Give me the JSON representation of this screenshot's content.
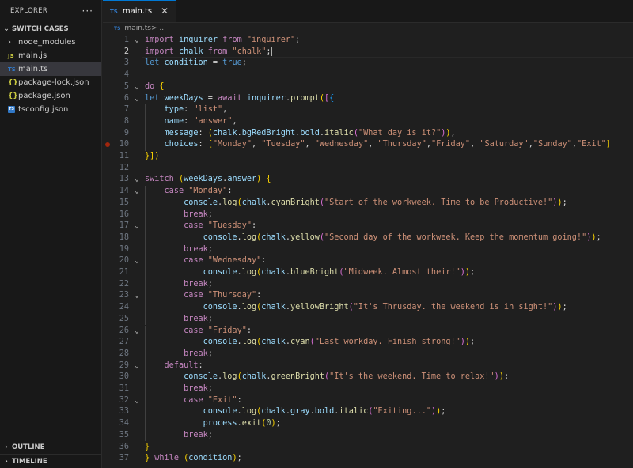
{
  "sidebar": {
    "title": "EXPLORER",
    "more": "···",
    "project": "SWITCH CASES",
    "items": [
      {
        "icon": "›",
        "label": "node_modules"
      },
      {
        "icon": "JS",
        "label": "main.js"
      },
      {
        "icon": "TS",
        "label": "main.ts"
      },
      {
        "icon": "{}",
        "label": "package-lock.json"
      },
      {
        "icon": "{}",
        "label": "package.json"
      },
      {
        "icon": "TS",
        "label": "tsconfig.json"
      }
    ],
    "outline": "OUTLINE",
    "timeline": "TIMELINE"
  },
  "tab": {
    "icon": "TS",
    "label": "main.ts",
    "close": "✕"
  },
  "breadcrumb": {
    "icon": "TS",
    "file": "main.ts",
    "sep": " > ..."
  },
  "editor": {
    "current_line": 2,
    "lines": [
      {
        "n": "1",
        "text": "import inquirer from \"inquirer\";"
      },
      {
        "n": "2",
        "text": "import chalk from \"chalk\";"
      },
      {
        "n": "3",
        "text": "let condition = true;"
      },
      {
        "n": "4",
        "text": ""
      },
      {
        "n": "5",
        "text": "do {"
      },
      {
        "n": "6",
        "text": "let weekDays = await inquirer.prompt([{"
      },
      {
        "n": "7",
        "text": "    type: \"list\","
      },
      {
        "n": "8",
        "text": "    name: \"answer\","
      },
      {
        "n": "9",
        "text": "    message: (chalk.bgRedBright.bold.italic(\"What day is it?\")),"
      },
      {
        "n": "10",
        "text": "    choices: [\"Monday\", \"Tuesday\", \"Wednesday\", \"Thursday\",\"Friday\", \"Saturday\",\"Sunday\",\"Exit\"]"
      },
      {
        "n": "11",
        "text": "}])"
      },
      {
        "n": "12",
        "text": ""
      },
      {
        "n": "13",
        "text": "switch (weekDays.answer) {"
      },
      {
        "n": "14",
        "text": "    case \"Monday\":"
      },
      {
        "n": "15",
        "text": "        console.log(chalk.cyanBright(\"Start of the workweek. Time to be Productive!\"));"
      },
      {
        "n": "16",
        "text": "        break;"
      },
      {
        "n": "17",
        "text": "        case \"Tuesday\":"
      },
      {
        "n": "18",
        "text": "            console.log(chalk.yellow(\"Second day of the workweek. Keep the momentum going!\"));"
      },
      {
        "n": "19",
        "text": "        break;"
      },
      {
        "n": "20",
        "text": "        case \"Wednesday\":"
      },
      {
        "n": "21",
        "text": "            console.log(chalk.blueBright(\"Midweek. Almost their!\"));"
      },
      {
        "n": "22",
        "text": "        break;"
      },
      {
        "n": "23",
        "text": "        case \"Thursday\":"
      },
      {
        "n": "24",
        "text": "            console.log(chalk.yellowBright(\"It's Thrusday. the weekend is in sight!\"));"
      },
      {
        "n": "25",
        "text": "        break;"
      },
      {
        "n": "26",
        "text": "        case \"Friday\":"
      },
      {
        "n": "27",
        "text": "            console.log(chalk.cyan(\"Last workday. Finish strong!\"));"
      },
      {
        "n": "28",
        "text": "        break;"
      },
      {
        "n": "29",
        "text": "    default:"
      },
      {
        "n": "30",
        "text": "        console.log(chalk.greenBright(\"It's the weekend. Time to relax!\"));"
      },
      {
        "n": "31",
        "text": "        break;"
      },
      {
        "n": "32",
        "text": "        case \"Exit\":"
      },
      {
        "n": "33",
        "text": "            console.log(chalk.gray.bold.italic(\"Exiting...\"));"
      },
      {
        "n": "34",
        "text": "            process.exit(0);"
      },
      {
        "n": "35",
        "text": "        break;"
      },
      {
        "n": "36",
        "text": "}"
      },
      {
        "n": "37",
        "text": "} while (condition);"
      }
    ]
  },
  "colors": {
    "accent": "#0078d4",
    "breakpoint": "#a1260d",
    "ts_icon": "#3178c6",
    "js_icon": "#cbcb41"
  }
}
